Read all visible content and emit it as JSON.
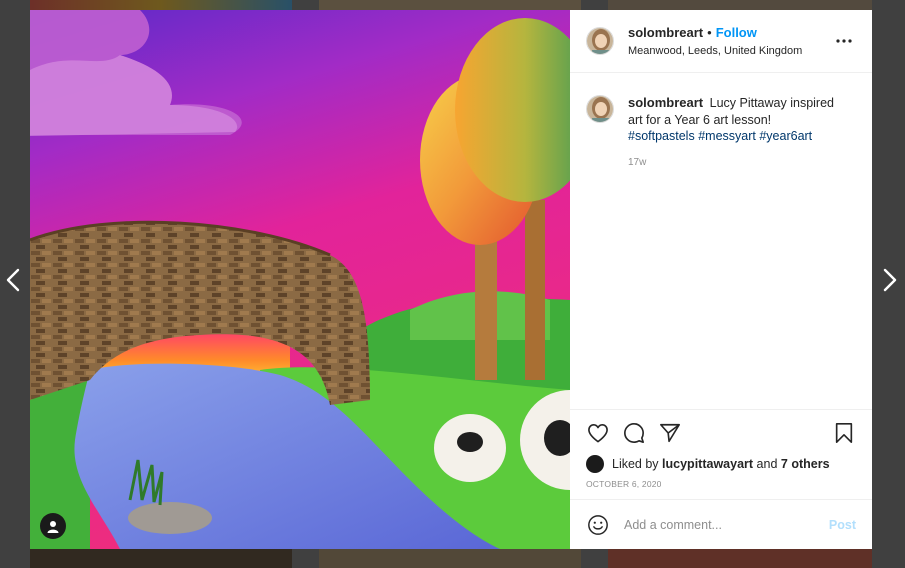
{
  "post": {
    "username": "solombreart",
    "follow_label": "Follow",
    "location": "Meanwood, Leeds, United Kingdom",
    "caption_username": "solombreart",
    "caption_text": "Lucy Pittaway inspired art for a Year 6 art lesson!",
    "hashtags": [
      "#softpastels",
      "#messyart",
      "#year6art"
    ],
    "time_ago": "17w",
    "liked_by_prefix": "Liked by",
    "liked_by_user": "lucypittawayart",
    "liked_by_and": "and",
    "liked_by_others": "7 others",
    "date": "OCTOBER 6, 2020"
  },
  "comment_box": {
    "placeholder": "Add a comment...",
    "post_label": "Post"
  },
  "icons": {
    "prev": "chevron-left-icon",
    "next": "chevron-right-icon",
    "more": "more-options-icon",
    "like": "heart-icon",
    "comment": "comment-bubble-icon",
    "share": "paper-plane-icon",
    "save": "bookmark-icon",
    "emoji": "smiley-icon",
    "user_tag": "user-tag-icon"
  },
  "colors": {
    "link_blue": "#0095f6",
    "hashtag": "#00376b",
    "text": "#262626",
    "muted": "#8e8e8e",
    "post_disabled": "#b2dffc"
  }
}
